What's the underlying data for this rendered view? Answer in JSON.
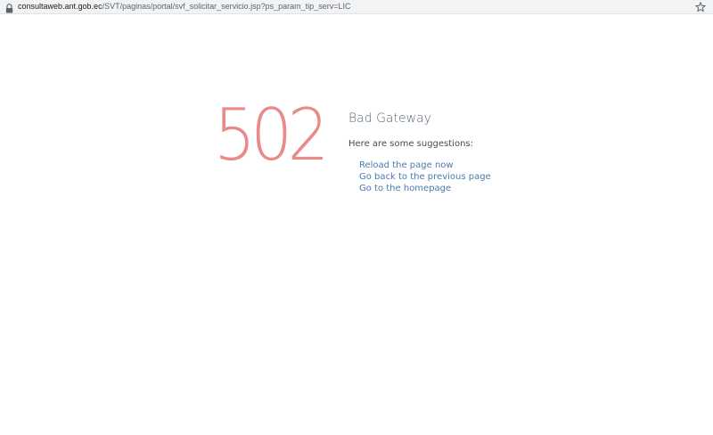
{
  "browser": {
    "url_host": "consultaweb.ant.gob.ec",
    "url_path": "/SVT/paginas/portal/svf_solicitar_servicio.jsp?ps_param_tip_serv=LIC",
    "icons": {
      "lock": "lock-icon",
      "bookmark": "star-icon"
    }
  },
  "error": {
    "code": "502",
    "title": "Bad Gateway",
    "suggestions_label": "Here are some suggestions:",
    "suggestions": [
      {
        "label": "Reload the page now"
      },
      {
        "label": "Go back to the previous page"
      },
      {
        "label": "Go to the homepage"
      }
    ]
  },
  "colors": {
    "code": "#e88a8a",
    "title": "#5a6a7a",
    "link": "#4a7ab0"
  }
}
